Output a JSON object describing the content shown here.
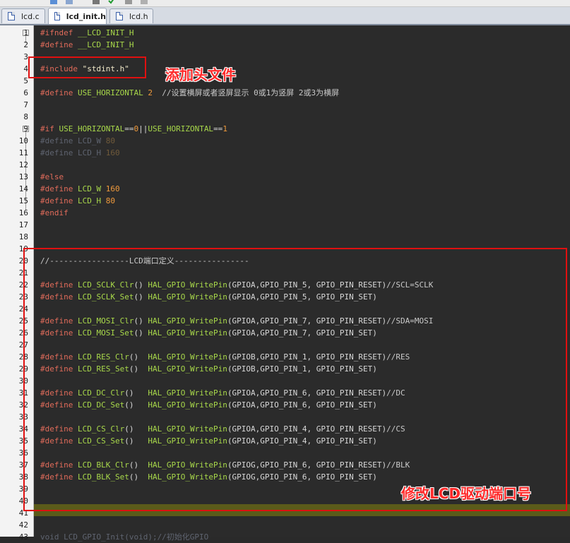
{
  "tabs": [
    {
      "label": "lcd.c",
      "active": false
    },
    {
      "label": "lcd_init.h",
      "active": true
    },
    {
      "label": "lcd.h",
      "active": false
    }
  ],
  "annotations": {
    "add_header": "添加头文件",
    "modify_ports": "修改LCD驱动端口号"
  },
  "lines": [
    {
      "n": "1",
      "segs": [
        [
          "pp",
          "#ifndef "
        ],
        [
          "id",
          "__LCD_INIT_H"
        ]
      ]
    },
    {
      "n": "2",
      "segs": [
        [
          "pp",
          "#define "
        ],
        [
          "id",
          "__LCD_INIT_H"
        ]
      ]
    },
    {
      "n": "3",
      "segs": []
    },
    {
      "n": "4",
      "segs": [
        [
          "pp",
          "#include "
        ],
        [
          "str",
          "\"stdint.h\""
        ]
      ]
    },
    {
      "n": "5",
      "segs": []
    },
    {
      "n": "6",
      "segs": [
        [
          "pp",
          "#define "
        ],
        [
          "id",
          "USE_HORIZONTAL "
        ],
        [
          "num",
          "2"
        ],
        [
          "cmt",
          "  //设置横屏或者竖屏显示 0或1为竖屏 2或3为横屏"
        ]
      ]
    },
    {
      "n": "7",
      "segs": []
    },
    {
      "n": "8",
      "segs": []
    },
    {
      "n": "9",
      "segs": [
        [
          "pp",
          "#if "
        ],
        [
          "id",
          "USE_HORIZONTAL"
        ],
        [
          "op",
          "=="
        ],
        [
          "num",
          "0"
        ],
        [
          "op",
          "||"
        ],
        [
          "id",
          "USE_HORIZONTAL"
        ],
        [
          "op",
          "=="
        ],
        [
          "num",
          "1"
        ]
      ]
    },
    {
      "n": "10",
      "segs": [
        [
          "grey",
          "#define LCD_W "
        ],
        [
          "gnum",
          "80"
        ]
      ]
    },
    {
      "n": "11",
      "segs": [
        [
          "grey",
          "#define LCD_H "
        ],
        [
          "gnum",
          "160"
        ]
      ]
    },
    {
      "n": "12",
      "segs": []
    },
    {
      "n": "13",
      "segs": [
        [
          "pp",
          "#else"
        ]
      ]
    },
    {
      "n": "14",
      "segs": [
        [
          "pp",
          "#define "
        ],
        [
          "id",
          "LCD_W "
        ],
        [
          "num",
          "160"
        ]
      ]
    },
    {
      "n": "15",
      "segs": [
        [
          "pp",
          "#define "
        ],
        [
          "id",
          "LCD_H "
        ],
        [
          "num",
          "80"
        ]
      ]
    },
    {
      "n": "16",
      "segs": [
        [
          "pp",
          "#endif"
        ]
      ]
    },
    {
      "n": "17",
      "segs": []
    },
    {
      "n": "18",
      "segs": []
    },
    {
      "n": "19",
      "segs": []
    },
    {
      "n": "20",
      "segs": [
        [
          "cmt",
          "//-----------------LCD端口定义----------------"
        ]
      ]
    },
    {
      "n": "21",
      "segs": []
    },
    {
      "n": "22",
      "segs": [
        [
          "pp",
          "#define "
        ],
        [
          "id",
          "LCD_SCLK_Clr"
        ],
        [
          "op",
          "() "
        ],
        [
          "id",
          "HAL_GPIO_WritePin"
        ],
        [
          "op",
          "(GPIOA,GPIO_PIN_5, GPIO_PIN_RESET)"
        ],
        [
          "cmt",
          "//SCL=SCLK"
        ]
      ]
    },
    {
      "n": "23",
      "segs": [
        [
          "pp",
          "#define "
        ],
        [
          "id",
          "LCD_SCLK_Set"
        ],
        [
          "op",
          "() "
        ],
        [
          "id",
          "HAL_GPIO_WritePin"
        ],
        [
          "op",
          "(GPIOA,GPIO_PIN_5, GPIO_PIN_SET)"
        ]
      ]
    },
    {
      "n": "24",
      "segs": []
    },
    {
      "n": "25",
      "segs": [
        [
          "pp",
          "#define "
        ],
        [
          "id",
          "LCD_MOSI_Clr"
        ],
        [
          "op",
          "() "
        ],
        [
          "id",
          "HAL_GPIO_WritePin"
        ],
        [
          "op",
          "(GPIOA,GPIO_PIN_7, GPIO_PIN_RESET)"
        ],
        [
          "cmt",
          "//SDA=MOSI"
        ]
      ]
    },
    {
      "n": "26",
      "segs": [
        [
          "pp",
          "#define "
        ],
        [
          "id",
          "LCD_MOSI_Set"
        ],
        [
          "op",
          "() "
        ],
        [
          "id",
          "HAL_GPIO_WritePin"
        ],
        [
          "op",
          "(GPIOA,GPIO_PIN_7, GPIO_PIN_SET)"
        ]
      ]
    },
    {
      "n": "27",
      "segs": []
    },
    {
      "n": "28",
      "segs": [
        [
          "pp",
          "#define "
        ],
        [
          "id",
          "LCD_RES_Clr"
        ],
        [
          "op",
          "()  "
        ],
        [
          "id",
          "HAL_GPIO_WritePin"
        ],
        [
          "op",
          "(GPIOB,GPIO_PIN_1, GPIO_PIN_RESET)"
        ],
        [
          "cmt",
          "//RES"
        ]
      ]
    },
    {
      "n": "29",
      "segs": [
        [
          "pp",
          "#define "
        ],
        [
          "id",
          "LCD_RES_Set"
        ],
        [
          "op",
          "()  "
        ],
        [
          "id",
          "HAL_GPIO_WritePin"
        ],
        [
          "op",
          "(GPIOB,GPIO_PIN_1, GPIO_PIN_SET)"
        ]
      ]
    },
    {
      "n": "30",
      "segs": []
    },
    {
      "n": "31",
      "segs": [
        [
          "pp",
          "#define "
        ],
        [
          "id",
          "LCD_DC_Clr"
        ],
        [
          "op",
          "()   "
        ],
        [
          "id",
          "HAL_GPIO_WritePin"
        ],
        [
          "op",
          "(GPIOA,GPIO_PIN_6, GPIO_PIN_RESET)"
        ],
        [
          "cmt",
          "//DC"
        ]
      ]
    },
    {
      "n": "32",
      "segs": [
        [
          "pp",
          "#define "
        ],
        [
          "id",
          "LCD_DC_Set"
        ],
        [
          "op",
          "()   "
        ],
        [
          "id",
          "HAL_GPIO_WritePin"
        ],
        [
          "op",
          "(GPIOA,GPIO_PIN_6, GPIO_PIN_SET)"
        ]
      ]
    },
    {
      "n": "33",
      "segs": []
    },
    {
      "n": "34",
      "segs": [
        [
          "pp",
          "#define "
        ],
        [
          "id",
          "LCD_CS_Clr"
        ],
        [
          "op",
          "()   "
        ],
        [
          "id",
          "HAL_GPIO_WritePin"
        ],
        [
          "op",
          "(GPIOA,GPIO_PIN_4, GPIO_PIN_RESET)"
        ],
        [
          "cmt",
          "//CS"
        ]
      ]
    },
    {
      "n": "35",
      "segs": [
        [
          "pp",
          "#define "
        ],
        [
          "id",
          "LCD_CS_Set"
        ],
        [
          "op",
          "()   "
        ],
        [
          "id",
          "HAL_GPIO_WritePin"
        ],
        [
          "op",
          "(GPIOA,GPIO_PIN_4, GPIO_PIN_SET)"
        ]
      ]
    },
    {
      "n": "36",
      "segs": []
    },
    {
      "n": "37",
      "segs": [
        [
          "pp",
          "#define "
        ],
        [
          "id",
          "LCD_BLK_Clr"
        ],
        [
          "op",
          "()  "
        ],
        [
          "id",
          "HAL_GPIO_WritePin"
        ],
        [
          "op",
          "(GPIOG,GPIO_PIN_6, GPIO_PIN_RESET)"
        ],
        [
          "cmt",
          "//BLK"
        ]
      ]
    },
    {
      "n": "38",
      "segs": [
        [
          "pp",
          "#define "
        ],
        [
          "id",
          "LCD_BLK_Set"
        ],
        [
          "op",
          "()  "
        ],
        [
          "id",
          "HAL_GPIO_WritePin"
        ],
        [
          "op",
          "(GPIOG,GPIO_PIN_6, GPIO_PIN_SET)"
        ]
      ]
    },
    {
      "n": "39",
      "segs": []
    },
    {
      "n": "40",
      "segs": []
    },
    {
      "n": "41",
      "segs": []
    },
    {
      "n": "42",
      "segs": []
    },
    {
      "n": "43",
      "segs": [
        [
          "grey",
          "void LCD_GPIO_Init(void);//初始化GPIO"
        ]
      ]
    }
  ]
}
